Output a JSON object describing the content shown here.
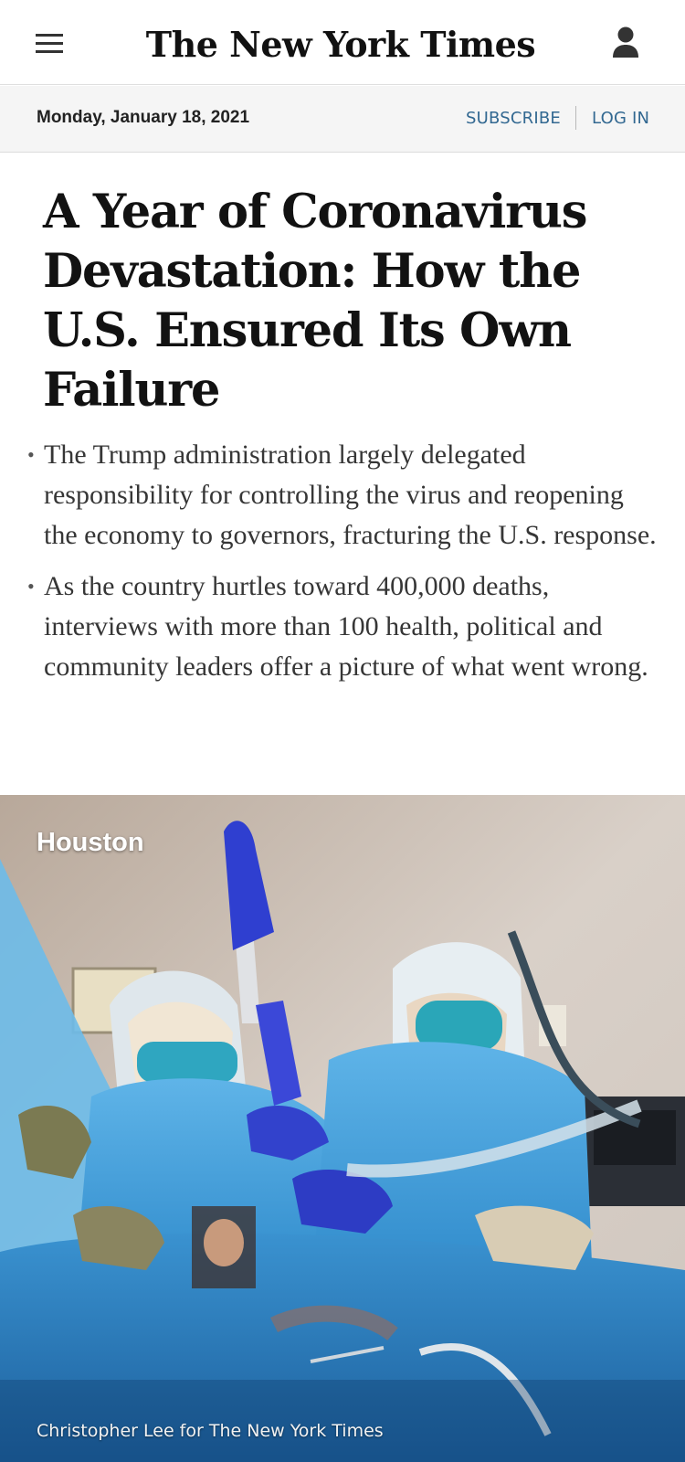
{
  "header": {
    "logo_text": "The New York Times",
    "menu_icon": "hamburger-menu-icon",
    "account_icon": "user-account-icon"
  },
  "datebar": {
    "date": "Monday, January 18, 2021",
    "subscribe_label": "SUBSCRIBE",
    "login_label": "LOG IN"
  },
  "article": {
    "headline": "A Year of Coronavirus Devastation: How the U.S. Ensured Its Own Failure",
    "summary": [
      "The Trump administration largely delegated responsibility for controlling the virus and reopening the economy to governors, fracturing the U.S. response.",
      "As the country hurtles toward 400,000 deaths, interviews with more than 100 health, political and community leaders offer a picture of what went wrong."
    ],
    "photo": {
      "location": "Houston",
      "credit": "Christopher Lee for The New York Times"
    }
  },
  "colors": {
    "link": "#326891",
    "datebar_bg": "#f5f5f5",
    "text": "#121212"
  }
}
